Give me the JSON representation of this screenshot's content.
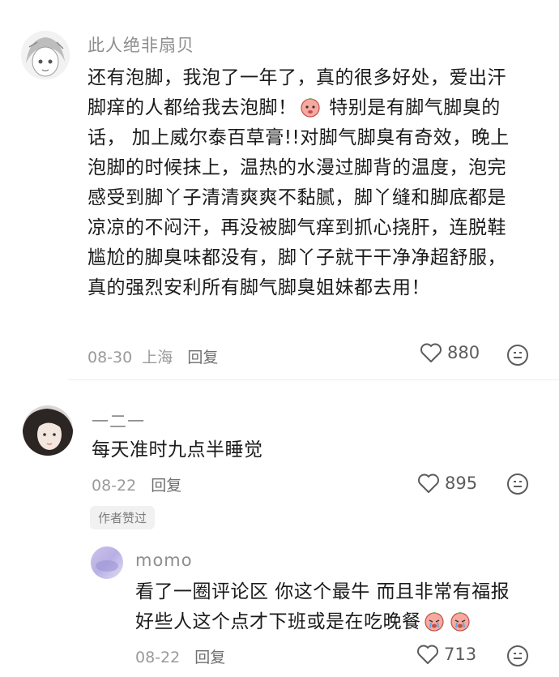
{
  "comments": [
    {
      "username": "此人绝非扇贝",
      "text": "还有泡脚，我泡了一年了，真的很多好处，爱出汗脚痒的人都给我去泡脚！",
      "text_after_emoji": " 特别是有脚气脚臭的话， 加上威尔泰百草膏!!对脚气脚臭有奇效，晚上泡脚的时候抹上，温热的水漫过脚背的温度，泡完感受到脚丫子清清爽爽不黏腻，脚丫缝和脚底都是凉凉的不闷汗，再没被脚气痒到抓心挠肝，连脱鞋尴尬的脚臭味都没有，脚丫子就干干净净超舒服，真的强烈安利所有脚气脚臭姐妹都去用！",
      "date": "08-30",
      "location": "上海",
      "reply_label": "回复",
      "likes": "880"
    },
    {
      "username": "一二一",
      "text": "每天准时九点半睡觉",
      "date": "08-22",
      "reply_label": "回复",
      "likes": "895",
      "badge": "作者赞过"
    },
    {
      "username": "momo",
      "text": "看了一圈评论区 你这个最牛 而且非常有福报好些人这个点才下班或是在吃晚餐",
      "date": "08-22",
      "reply_label": "回复",
      "likes": "713"
    }
  ],
  "icons": {
    "like": "heart-outline-icon",
    "react": "smiley-face-icon",
    "emoji_inline": "peach-character-emoji"
  },
  "colors": {
    "username": "#8e8e8e",
    "body_text": "#1b1b1b",
    "meta": "#9a9a9a",
    "badge_bg": "#f1f1f1"
  }
}
